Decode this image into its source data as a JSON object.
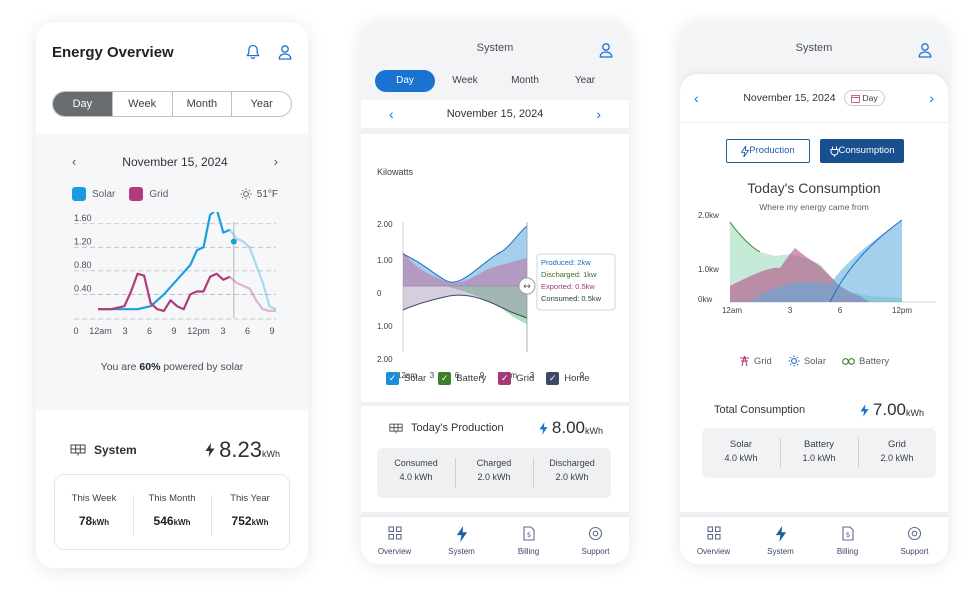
{
  "screen1": {
    "title": "Energy Overview",
    "tabs": [
      {
        "label": "Day",
        "active": true
      },
      {
        "label": "Week"
      },
      {
        "label": "Month"
      },
      {
        "label": "Year"
      }
    ],
    "date": "November 15, 2024",
    "legend": {
      "solar": "Solar",
      "grid": "Grid",
      "weather": "51°F"
    },
    "chart_data": {
      "type": "line",
      "yticks": [
        "1.60",
        "1.20",
        "0.80",
        "0.40"
      ],
      "ylim": [
        0,
        1.8
      ],
      "xticks": [
        "0",
        "12am",
        "3",
        "6",
        "9",
        "12pm",
        "3",
        "6",
        "9"
      ],
      "series": [
        {
          "name": "Solar",
          "color": "#1aa0e0",
          "points": [
            [
              0,
              0.15
            ],
            [
              1,
              0.15
            ],
            [
              2,
              0.15
            ],
            [
              3,
              0.15
            ],
            [
              4,
              0.2
            ],
            [
              5,
              0.4
            ],
            [
              6,
              0.65
            ],
            [
              7,
              0.9
            ],
            [
              7.5,
              1.15
            ],
            [
              8,
              1.2
            ],
            [
              8.5,
              1.75
            ],
            [
              9,
              1.85
            ],
            [
              9.5,
              1.45
            ],
            [
              10,
              1.5
            ],
            [
              10.5,
              1.35
            ],
            [
              11,
              1.3
            ],
            [
              11.5,
              1.2
            ],
            [
              12,
              0.9
            ],
            [
              12.5,
              0.6
            ],
            [
              13,
              0.2
            ],
            [
              13.5,
              0.15
            ]
          ]
        },
        {
          "name": "Grid",
          "color": "#b03a7a",
          "points": [
            [
              0,
              0.15
            ],
            [
              1,
              0.15
            ],
            [
              2,
              0.2
            ],
            [
              2.5,
              0.45
            ],
            [
              3,
              0.75
            ],
            [
              3.5,
              0.72
            ],
            [
              4,
              0.25
            ],
            [
              4.5,
              0.15
            ],
            [
              5,
              0.12
            ],
            [
              5.5,
              0.3
            ],
            [
              6,
              0.2
            ],
            [
              6.5,
              0.15
            ],
            [
              7,
              0.4
            ],
            [
              7.5,
              0.45
            ],
            [
              8,
              0.45
            ],
            [
              8.5,
              0.7
            ],
            [
              9,
              0.75
            ],
            [
              9.5,
              0.65
            ],
            [
              10,
              0.7
            ],
            [
              10.5,
              0.6
            ],
            [
              11,
              0.55
            ],
            [
              11.5,
              0.5
            ],
            [
              12,
              0.3
            ],
            [
              12.5,
              0.15
            ],
            [
              13,
              0.12
            ],
            [
              13.5,
              0.12
            ]
          ]
        }
      ]
    },
    "solar_note_pre": "You are ",
    "solar_note_pct": "60%",
    "solar_note_post": " powered by solar",
    "system": {
      "label": "System",
      "value": "8.23",
      "unit": "kWh"
    },
    "totals": [
      {
        "label": "This Week",
        "value": "78",
        "unit": "kWh"
      },
      {
        "label": "This Month",
        "value": "546",
        "unit": "kWh"
      },
      {
        "label": "This Year",
        "value": "752",
        "unit": "kWh"
      }
    ]
  },
  "screen2": {
    "title": "System",
    "tabs": [
      {
        "label": "Day",
        "active": true
      },
      {
        "label": "Week"
      },
      {
        "label": "Month"
      },
      {
        "label": "Year"
      }
    ],
    "date": "November 15, 2024",
    "ylabel": "Kilowatts",
    "chart_data": {
      "type": "area",
      "yticks": [
        "2.00",
        "1.00",
        "0",
        "1.00",
        "2.00"
      ],
      "xticks": [
        "12am",
        "3",
        "6",
        "9",
        "12pm",
        "3",
        "6",
        "9"
      ],
      "tooltip": [
        {
          "label": "Produced:",
          "value": "2kw",
          "color": "#1a6fc0"
        },
        {
          "label": "Discharged:",
          "value": "1kw",
          "color": "#3f6f2a"
        },
        {
          "label": "Exported:",
          "value": "0.5kw",
          "color": "#a33a78"
        },
        {
          "label": "Consumed:",
          "value": "0.5kw",
          "color": "#333a45"
        }
      ]
    },
    "legend": [
      {
        "label": "Solar",
        "color": "#1a8fd8"
      },
      {
        "label": "Battery",
        "color": "#3f7f2a"
      },
      {
        "label": "Grid",
        "color": "#a33a78"
      },
      {
        "label": "Home",
        "color": "#3b4a66"
      }
    ],
    "production": {
      "label": "Today's Production",
      "value": "8.00",
      "unit": "kWh"
    },
    "stats": [
      {
        "label": "Consumed",
        "value": "4.0 kWh"
      },
      {
        "label": "Charged",
        "value": "2.0 kWh"
      },
      {
        "label": "Discharged",
        "value": "2.0 kWh"
      }
    ]
  },
  "screen3": {
    "title": "System",
    "date": "November 15, 2024",
    "day_pill": "Day",
    "btn_production": "Production",
    "btn_consumption": "Consumption",
    "chart_title": "Today's Consumption",
    "chart_subtitle": "Where my energy came from",
    "chart_data": {
      "type": "area",
      "yticks": [
        "2.0kw",
        "1.0kw",
        "0kw"
      ],
      "xticks": [
        "12am",
        "3",
        "6",
        "12pm"
      ]
    },
    "legend": [
      {
        "label": "Grid"
      },
      {
        "label": "Solar"
      },
      {
        "label": "Battery"
      }
    ],
    "total": {
      "label": "Total Consumption",
      "value": "7.00",
      "unit": "kWh"
    },
    "stats": [
      {
        "label": "Solar",
        "value": "4.0 kWh"
      },
      {
        "label": "Battery",
        "value": "1.0 kWh"
      },
      {
        "label": "Grid",
        "value": "2.0 kWh"
      }
    ]
  },
  "nav": [
    {
      "label": "Overview"
    },
    {
      "label": "System"
    },
    {
      "label": "Billing"
    },
    {
      "label": "Support"
    }
  ]
}
